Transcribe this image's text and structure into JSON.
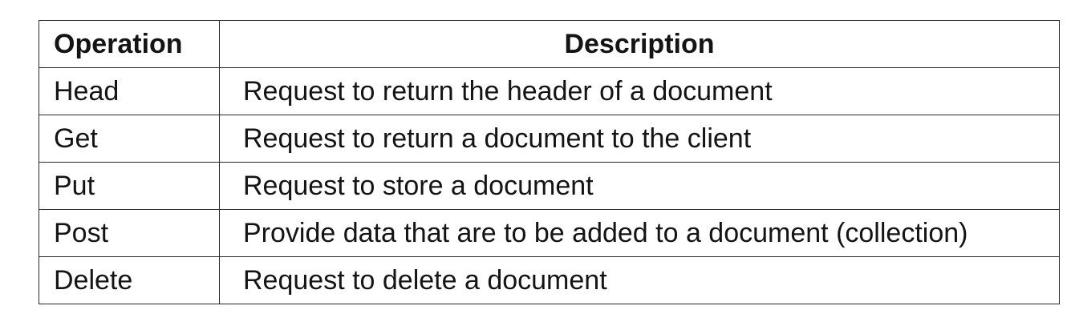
{
  "table": {
    "headers": {
      "operation": "Operation",
      "description": "Description"
    },
    "rows": [
      {
        "operation": "Head",
        "description": "Request to return the header of a document"
      },
      {
        "operation": "Get",
        "description": "Request to return a document to the client"
      },
      {
        "operation": "Put",
        "description": "Request to store a document"
      },
      {
        "operation": "Post",
        "description": "Provide data that are to be added to a document (collection)"
      },
      {
        "operation": "Delete",
        "description": "Request to delete a document"
      }
    ]
  }
}
